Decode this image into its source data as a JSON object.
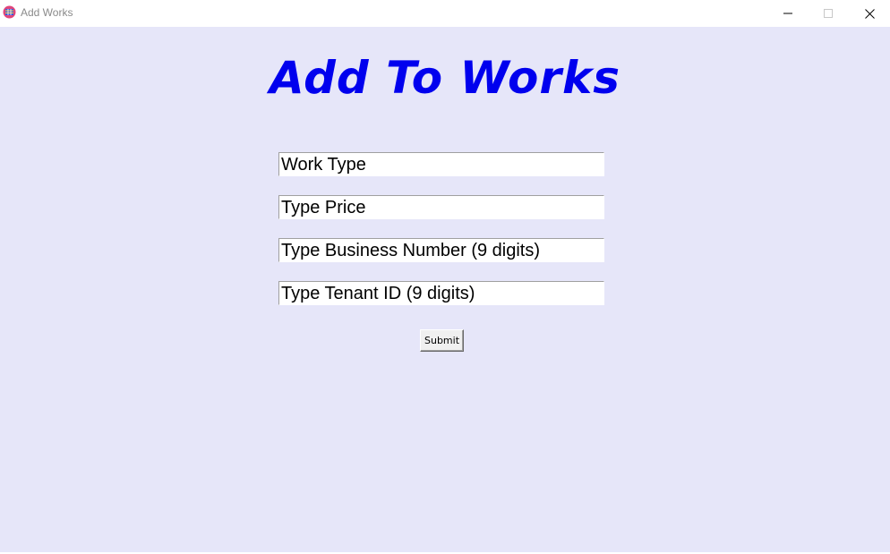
{
  "window": {
    "title": "Add Works",
    "icon": "feather-app-icon"
  },
  "heading": "Add To Works",
  "fields": [
    {
      "value": "Work Type"
    },
    {
      "value": "Type Price"
    },
    {
      "value": "Type Business Number (9 digits)"
    },
    {
      "value": "Type Tenant ID (9 digits)"
    }
  ],
  "submit_label": "Submit",
  "colors": {
    "background": "#e6e6f9",
    "heading": "#0000ee"
  }
}
